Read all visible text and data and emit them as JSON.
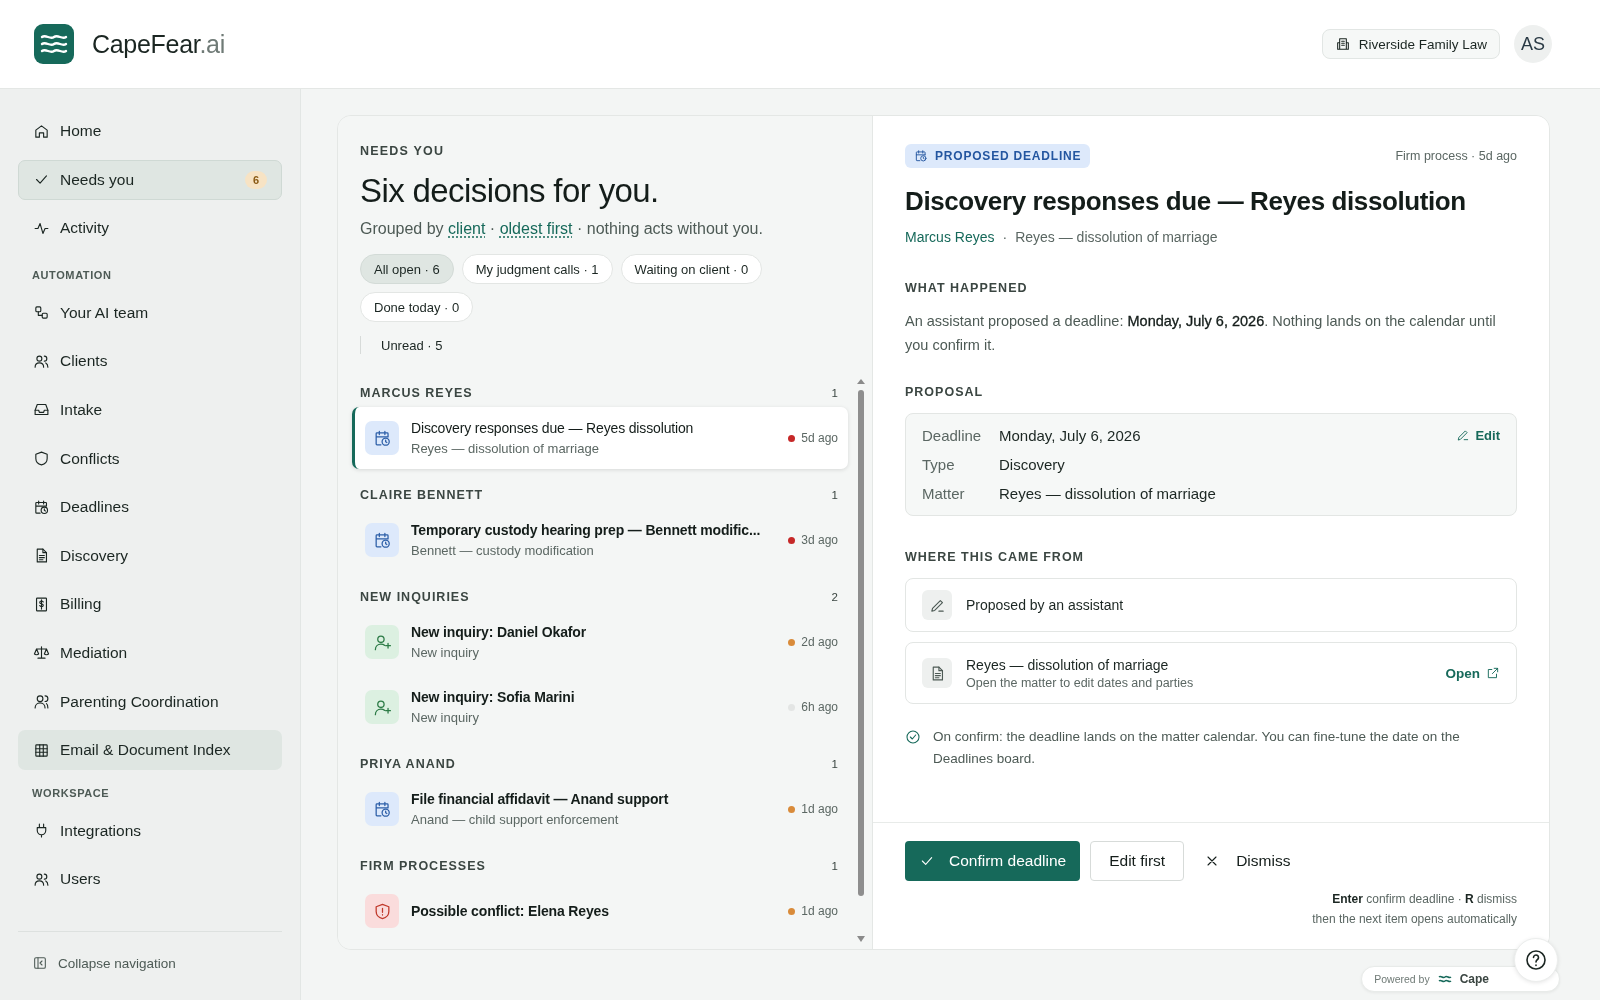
{
  "header": {
    "brand": {
      "name": "CapeFear",
      "suffix": ".ai"
    },
    "firm": "Riverside Family Law",
    "avatar": "AS"
  },
  "sidebar": {
    "groups": [
      {
        "items": [
          {
            "kind": "home",
            "label": "Home",
            "selected": false,
            "hovered": false
          },
          {
            "kind": "check",
            "label": "Needs you",
            "selected": true,
            "hovered": false,
            "badge": "6"
          },
          {
            "kind": "activity",
            "label": "Activity",
            "selected": false,
            "hovered": false
          }
        ]
      },
      {
        "heading": "AUTOMATION",
        "items": [
          {
            "kind": "team",
            "label": "Your AI team",
            "selected": false,
            "hovered": false
          },
          {
            "kind": "users",
            "label": "Clients",
            "selected": false,
            "hovered": false
          },
          {
            "kind": "inbox",
            "label": "Intake",
            "selected": false,
            "hovered": false
          },
          {
            "kind": "shield",
            "label": "Conflicts",
            "selected": false,
            "hovered": false
          },
          {
            "kind": "calendar",
            "label": "Deadlines",
            "selected": false,
            "hovered": false
          },
          {
            "kind": "file",
            "label": "Discovery",
            "selected": false,
            "hovered": false
          },
          {
            "kind": "billing",
            "label": "Billing",
            "selected": false,
            "hovered": false
          },
          {
            "kind": "scale",
            "label": "Mediation",
            "selected": false,
            "hovered": false
          },
          {
            "kind": "parent",
            "label": "Parenting Coordination",
            "selected": false,
            "hovered": false
          },
          {
            "kind": "grid",
            "label": "Email & Document Index",
            "selected": false,
            "hovered": true
          }
        ]
      },
      {
        "heading": "WORKSPACE",
        "items": [
          {
            "kind": "plug",
            "label": "Integrations",
            "selected": false,
            "hovered": false
          },
          {
            "kind": "users",
            "label": "Users",
            "selected": false,
            "hovered": false
          }
        ]
      }
    ],
    "collapse": "Collapse navigation"
  },
  "needs": {
    "eyebrow": "NEEDS YOU",
    "title": "Six decisions for you.",
    "subtitle": [
      {
        "text": "Grouped by "
      },
      {
        "text": "client",
        "link": true
      },
      {
        "text": " · "
      },
      {
        "text": "oldest first",
        "link": true
      },
      {
        "text": " · nothing acts without you."
      }
    ],
    "filters": [
      {
        "label": "All open · 6",
        "selected": true
      },
      {
        "label": "My judgment calls · 1",
        "selected": false
      },
      {
        "label": "Waiting on client · 0",
        "selected": false
      },
      {
        "label": "Done today · 0",
        "selected": false
      }
    ],
    "unread": "Unread · 5",
    "groups": [
      {
        "name": "MARCUS REYES",
        "count": "1",
        "items": [
          {
            "kind": "calendar",
            "title": "Discovery responses due — Reyes dissolution",
            "subtitle": "Reyes — dissolution of marriage",
            "time": "5d ago",
            "color": "#c62828",
            "unread": false,
            "selected": true
          }
        ]
      },
      {
        "name": "CLAIRE BENNETT",
        "count": "1",
        "items": [
          {
            "kind": "calendar",
            "title": "Temporary custody hearing prep — Bennett modific...",
            "subtitle": "Bennett — custody modification",
            "time": "3d ago",
            "color": "#c62828",
            "unread": true,
            "selected": false
          }
        ]
      },
      {
        "name": "NEW INQUIRIES",
        "count": "2",
        "items": [
          {
            "kind": "person-add",
            "title": "New inquiry: Daniel Okafor",
            "subtitle": "New inquiry",
            "time": "2d ago",
            "color": "#d98b3a",
            "unread": true,
            "selected": false
          },
          {
            "kind": "person-add",
            "title": "New inquiry: Sofia Marini",
            "subtitle": "New inquiry",
            "time": "6h ago",
            "color": "#e3e5e4",
            "unread": true,
            "selected": false
          }
        ]
      },
      {
        "name": "PRIYA ANAND",
        "count": "1",
        "items": [
          {
            "kind": "calendar",
            "title": "File financial affidavit — Anand support",
            "subtitle": "Anand — child support enforcement",
            "time": "1d ago",
            "color": "#d98b3a",
            "unread": true,
            "selected": false
          }
        ]
      },
      {
        "name": "FIRM PROCESSES",
        "count": "1",
        "items": [
          {
            "kind": "shield-alert",
            "title": "Possible conflict: Elena Reyes",
            "time": "1d ago",
            "color": "#d98b3a",
            "unread": true,
            "selected": false
          }
        ]
      }
    ]
  },
  "detail": {
    "badge": "PROPOSED DEADLINE",
    "meta": "Firm process · 5d ago",
    "title": "Discovery responses due — Reyes dissolution",
    "client": "Marcus Reyes",
    "separator": "·",
    "matter": "Reyes — dissolution of marriage",
    "what_happened": {
      "heading": "WHAT HAPPENED",
      "text": "An assistant proposed a deadline: **Monday, July 6, 2026**. Nothing lands on the calendar until you confirm it."
    },
    "proposal": {
      "heading": "PROPOSAL",
      "edit": "Edit",
      "rows": [
        {
          "label": "Deadline",
          "value": "Monday, July 6, 2026"
        },
        {
          "label": "Type",
          "value": "Discovery"
        },
        {
          "label": "Matter",
          "value": "Reyes — dissolution of marriage"
        }
      ]
    },
    "sources": {
      "heading": "WHERE THIS CAME FROM",
      "items": [
        {
          "kind": "pencil",
          "title": "Proposed by an assistant"
        },
        {
          "kind": "file",
          "title": "Reyes — dissolution of marriage",
          "subtitle": "Open the matter to edit dates and parties",
          "action": "Open"
        }
      ]
    },
    "note": "On confirm: the deadline lands on the matter calendar. You can fine-tune the date on the Deadlines board.",
    "actions": {
      "confirm": "Confirm deadline",
      "edit": "Edit first",
      "dismiss": "Dismiss"
    },
    "hints": [
      "**Enter** confirm deadline · **R** dismiss",
      "then the next item opens automatically"
    ]
  },
  "footer": {
    "powered_by": "Powered by",
    "brand": "Cape"
  }
}
